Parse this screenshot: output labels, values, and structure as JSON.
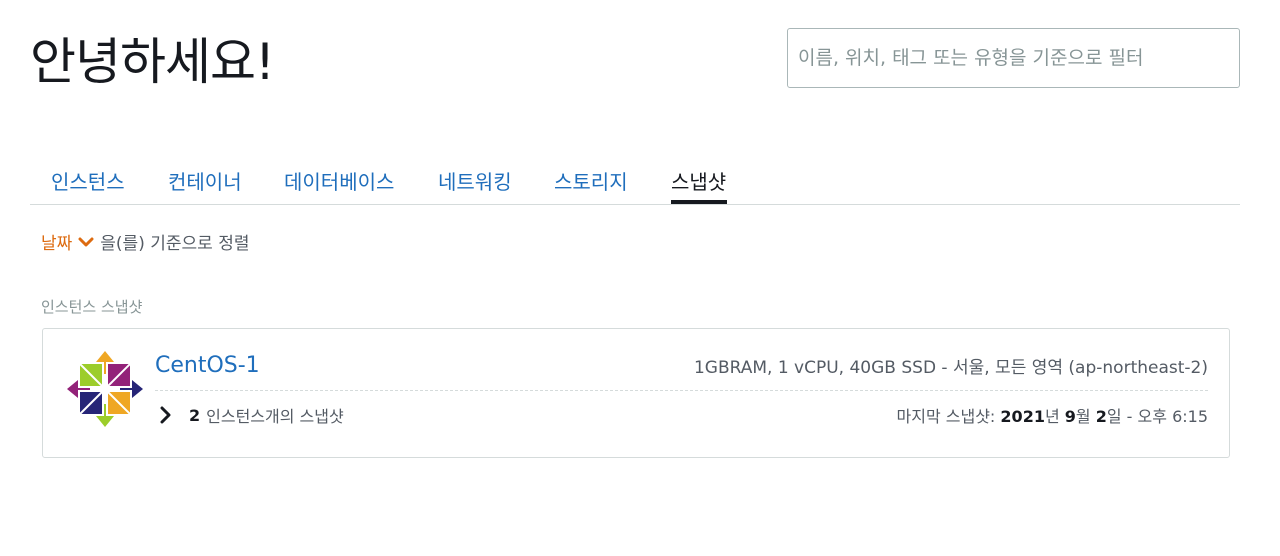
{
  "header": {
    "greeting": "안녕하세요!",
    "search_placeholder": "이름, 위치, 태그 또는 유형을 기준으로 필터"
  },
  "tabs": [
    {
      "label": "인스턴스",
      "active": false
    },
    {
      "label": "컨테이너",
      "active": false
    },
    {
      "label": "데이터베이스",
      "active": false
    },
    {
      "label": "네트워킹",
      "active": false
    },
    {
      "label": "스토리지",
      "active": false
    },
    {
      "label": "스냅샷",
      "active": true
    }
  ],
  "sort": {
    "key": "날짜",
    "suffix": "을(를) 기준으로 정렬"
  },
  "section": {
    "label": "인스턴스 스냅샷"
  },
  "snapshot_card": {
    "logo_icon": "centos-logo-icon",
    "name": "CentOS-1",
    "spec": "1GBRAM, 1 vCPU, 40GB SSD - 서울, 모든 영역 (ap-northeast-2)",
    "count": "2",
    "count_label": "인스턴스개의 스냅샷",
    "last_snapshot_label": "마지막 스냅샷: ",
    "year": "2021",
    "year_unit": "년 ",
    "month": "9",
    "month_unit": "월 ",
    "day": "2",
    "day_unit": "일",
    "time": " - 오후 6:15"
  },
  "colors": {
    "link": "#1f6ebc",
    "sort_accent": "#dd6b10",
    "text": "#16191f",
    "muted": "#879596",
    "border": "#d5dbdb"
  }
}
